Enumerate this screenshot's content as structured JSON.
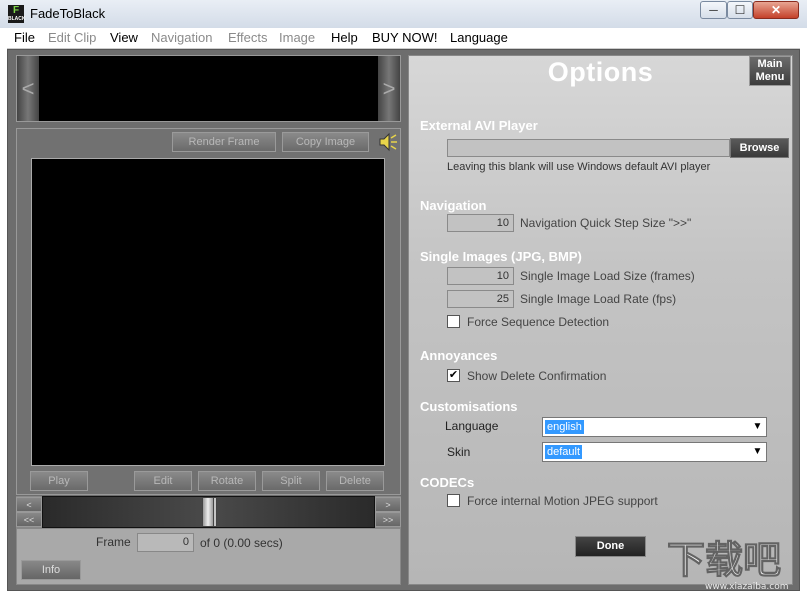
{
  "window": {
    "title": "FadeToBlack",
    "icon_text": "F",
    "icon_subtext": "BLACK"
  },
  "window_controls": {
    "minimize": "─",
    "maximize": "☐",
    "close": "✕"
  },
  "menu": [
    {
      "label": "File",
      "enabled": true
    },
    {
      "label": "Edit Clip",
      "enabled": false
    },
    {
      "label": "View",
      "enabled": true
    },
    {
      "label": "Navigation",
      "enabled": false
    },
    {
      "label": "Effects",
      "enabled": false
    },
    {
      "label": "Image",
      "enabled": false
    },
    {
      "label": "Help",
      "enabled": true
    },
    {
      "label": "BUY NOW!",
      "enabled": true
    },
    {
      "label": "Language",
      "enabled": true
    }
  ],
  "strip": {
    "left_arrow": "<",
    "right_arrow": ">"
  },
  "viewer": {
    "render_frame": "Render Frame",
    "copy_image": "Copy Image",
    "play": "Play",
    "edit": "Edit",
    "rotate": "Rotate",
    "split": "Split",
    "delete": "Delete"
  },
  "scrub": {
    "prev": "<",
    "first": "<<",
    "next": ">",
    "last": ">>"
  },
  "frame": {
    "label": "Frame",
    "value": "0",
    "of_text": "of 0 (0.00 secs)",
    "info": "Info"
  },
  "options": {
    "title": "Options",
    "main_menu_line1": "Main",
    "main_menu_line2": "Menu",
    "external_avi": {
      "heading": "External AVI Player",
      "path": "",
      "browse": "Browse",
      "note": "Leaving this blank will use Windows default AVI player"
    },
    "navigation": {
      "heading": "Navigation",
      "step_value": "10",
      "step_label": "Navigation Quick Step Size \">>\""
    },
    "single_images": {
      "heading": "Single Images (JPG, BMP)",
      "load_size_value": "10",
      "load_size_label": "Single Image Load Size (frames)",
      "load_rate_value": "25",
      "load_rate_label": "Single Image Load Rate (fps)",
      "force_seq_label": "Force Sequence Detection",
      "force_seq_checked": false
    },
    "annoyances": {
      "heading": "Annoyances",
      "show_delete_label": "Show Delete Confirmation",
      "show_delete_checked": true,
      "check_mark": "✔"
    },
    "customisations": {
      "heading": "Customisations",
      "language_label": "Language",
      "language_value": "english",
      "skin_label": "Skin",
      "skin_value": "default",
      "dropdown_glyph": "▼"
    },
    "codecs": {
      "heading": "CODECs",
      "force_mjpeg_label": "Force internal Motion JPEG support",
      "force_mjpeg_checked": false
    },
    "done": "Done"
  },
  "watermark": {
    "text": "下载吧",
    "site": "www.xiazaiba.com"
  },
  "colors": {
    "panel_bg": "#6d6d6d",
    "options_bg": "#c8c8c8",
    "select_highlight": "#3399ff",
    "heading_white": "#ffffff"
  }
}
